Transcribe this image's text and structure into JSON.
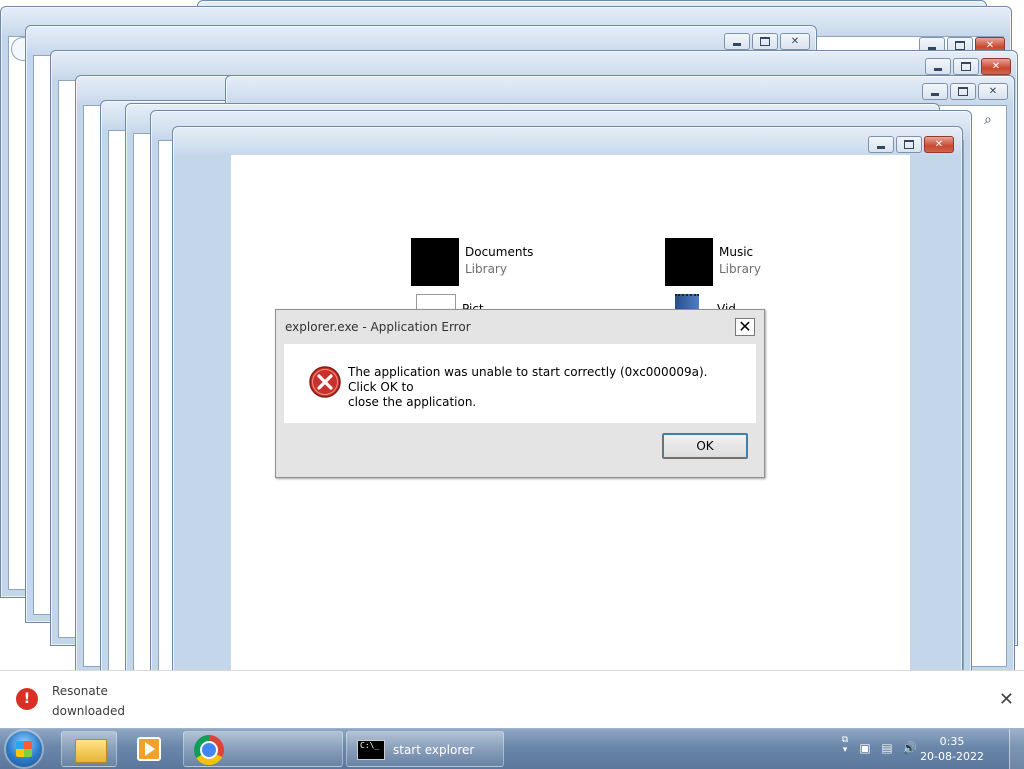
{
  "explorer": {
    "libraries": [
      {
        "name": "Documents",
        "sub": "Library"
      },
      {
        "name": "Music",
        "sub": "Library"
      },
      {
        "name": "Pict",
        "sub": ""
      },
      {
        "name": "Vid",
        "sub": ""
      }
    ]
  },
  "dialog": {
    "title": "explorer.exe - Application Error",
    "message_line1": "The application was unable to start correctly (0xc000009a). Click OK to",
    "message_line2": "close the application.",
    "ok_label": "OK",
    "close_glyph": "✕",
    "icon": "error-icon"
  },
  "notification": {
    "line1": "Resonate",
    "line2": "downloaded",
    "close_glyph": "✕",
    "alert_glyph": "!"
  },
  "taskbar": {
    "items": [
      {
        "icon": "explorer-folder-icon"
      },
      {
        "icon": "media-player-icon"
      },
      {
        "icon": "chrome-icon"
      },
      {
        "icon": "cmd-icon",
        "label": "start  explorer",
        "glyph": "C:\\_"
      }
    ],
    "clock": {
      "time": "0:35",
      "date": "20-08-2022"
    }
  },
  "colors": {
    "close_button": "#c8482f",
    "frame": "#c4d6ea",
    "error_red": "#d93025",
    "taskbar": "#6a86a9"
  }
}
